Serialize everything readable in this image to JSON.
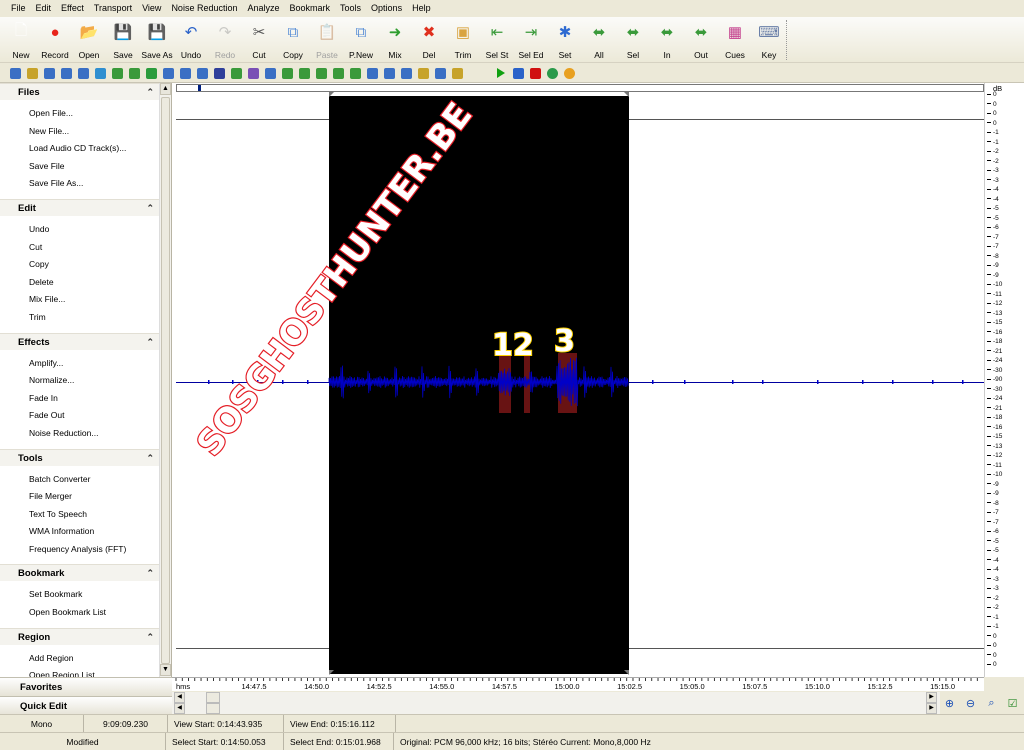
{
  "menu": [
    "File",
    "Edit",
    "Effect",
    "Transport",
    "View",
    "Noise Reduction",
    "Analyze",
    "Bookmark",
    "Tools",
    "Options",
    "Help"
  ],
  "toolbar": [
    {
      "label": "New",
      "icon": "new-file-icon",
      "glyph": "🗋",
      "color": "#ffffff",
      "disabled": false
    },
    {
      "label": "Record",
      "icon": "record-icon",
      "glyph": "●",
      "color": "#e8241a",
      "disabled": false
    },
    {
      "label": "Open",
      "icon": "folder-open-icon",
      "glyph": "📂",
      "color": "#f3c64a",
      "disabled": false
    },
    {
      "label": "Save",
      "icon": "save-icon",
      "glyph": "💾",
      "color": "#3d6fb5",
      "disabled": false
    },
    {
      "label": "Save As",
      "icon": "save-as-icon",
      "glyph": "💾",
      "color": "#3d6fb5",
      "disabled": false
    },
    {
      "label": "Undo",
      "icon": "undo-icon",
      "glyph": "↶",
      "color": "#2a62c9",
      "disabled": false
    },
    {
      "label": "Redo",
      "icon": "redo-icon",
      "glyph": "↷",
      "color": "#888888",
      "disabled": true
    },
    {
      "label": "Cut",
      "icon": "scissors-icon",
      "glyph": "✂",
      "color": "#555555",
      "disabled": false
    },
    {
      "label": "Copy",
      "icon": "copy-icon",
      "glyph": "⧉",
      "color": "#5a8fd6",
      "disabled": false
    },
    {
      "label": "Paste",
      "icon": "paste-icon",
      "glyph": "📋",
      "color": "#888888",
      "disabled": true
    },
    {
      "label": "P.New",
      "icon": "paste-new-icon",
      "glyph": "⧉",
      "color": "#5a8fd6",
      "disabled": false
    },
    {
      "label": "Mix",
      "icon": "mix-icon",
      "glyph": "➜",
      "color": "#2f9e2f",
      "disabled": false
    },
    {
      "label": "Del",
      "icon": "delete-icon",
      "glyph": "✖",
      "color": "#e0301e",
      "disabled": false
    },
    {
      "label": "Trim",
      "icon": "trim-icon",
      "glyph": "▣",
      "color": "#d9a441",
      "disabled": false
    },
    {
      "label": "Sel St",
      "icon": "select-start-icon",
      "glyph": "⇤",
      "color": "#3a9a3a",
      "disabled": false
    },
    {
      "label": "Sel Ed",
      "icon": "select-end-icon",
      "glyph": "⇥",
      "color": "#3a9a3a",
      "disabled": false
    },
    {
      "label": "Set",
      "icon": "set-marker-icon",
      "glyph": "✱",
      "color": "#2e6ad1",
      "disabled": false
    },
    {
      "label": "All",
      "icon": "select-all-icon",
      "glyph": "⬌",
      "color": "#3a9a3a",
      "disabled": false
    },
    {
      "label": "Sel",
      "icon": "select-icon",
      "glyph": "⬌",
      "color": "#3a9a3a",
      "disabled": false
    },
    {
      "label": "In",
      "icon": "zoom-in-region-icon",
      "glyph": "⬌",
      "color": "#3a9a3a",
      "disabled": false
    },
    {
      "label": "Out",
      "icon": "zoom-out-region-icon",
      "glyph": "⬌",
      "color": "#3a9a3a",
      "disabled": false
    },
    {
      "label": "Cues",
      "icon": "cues-icon",
      "glyph": "▦",
      "color": "#c23b8a",
      "disabled": false
    },
    {
      "label": "Key",
      "icon": "keyboard-icon",
      "glyph": "⌨",
      "color": "#6a7fa8",
      "disabled": false
    }
  ],
  "toolbar2_colors": [
    "#3a6fc4",
    "#c7a32a",
    "#3a6fc4",
    "#3a6fc4",
    "#3a6fc4",
    "#2f8fd0",
    "#3a9a3a",
    "#3a9a3a",
    "#2b9c3c",
    "#3a6fc4",
    "#3a6fc4",
    "#3a6fc4",
    "#2f3f9a",
    "#3a9a3a",
    "#7a4fb5",
    "#3a6fc4",
    "#3a9a3a",
    "#3a9a3a",
    "#3a9a3a",
    "#3a9a3a",
    "#3a9a3a",
    "#3a6fc4",
    "#3a6fc4",
    "#3a6fc4",
    "#c7a32a",
    "#3a6fc4",
    "#c7a32a"
  ],
  "transport_colors": [
    "#10a010",
    "#2a62c9",
    "#d01010",
    "#2a9a4a",
    "#e8a020"
  ],
  "sidebar": {
    "sections": [
      {
        "title": "Files",
        "items": [
          "Open File...",
          "New File...",
          "Load Audio CD Track(s)...",
          "Save File",
          "Save File As..."
        ]
      },
      {
        "title": "Edit",
        "items": [
          "Undo",
          "Cut",
          "Copy",
          "Delete",
          "Mix File...",
          "Trim"
        ]
      },
      {
        "title": "Effects",
        "items": [
          "Amplify...",
          "Normalize...",
          "Fade In",
          "Fade Out",
          "Noise Reduction..."
        ]
      },
      {
        "title": "Tools",
        "items": [
          "Batch Converter",
          "File Merger",
          "Text To Speech",
          "WMA Information",
          "Frequency Analysis (FFT)"
        ]
      },
      {
        "title": "Bookmark",
        "items": [
          "Set Bookmark",
          "Open Bookmark List"
        ]
      },
      {
        "title": "Region",
        "items": [
          "Add Region",
          "Open Region List"
        ]
      }
    ],
    "chevron": "⌃",
    "tabs": [
      "Favorites",
      "Quick Edit"
    ]
  },
  "watermark": "SOSGHOSTHUNTER.BE",
  "annotations": [
    "12",
    "3"
  ],
  "colors": {
    "waveform": "#0000c8",
    "selection": "#000000",
    "highlight": "#7a1616",
    "watermark": "#e41e26",
    "annotation": "#ffd400"
  },
  "db_scale": {
    "unit": "dB",
    "ticks": [
      "0",
      "0",
      "0",
      "0",
      "-1",
      "-1",
      "-2",
      "-2",
      "-3",
      "-3",
      "-4",
      "-4",
      "-5",
      "-5",
      "-6",
      "-7",
      "-7",
      "-8",
      "-9",
      "-9",
      "-10",
      "-11",
      "-12",
      "-13",
      "-15",
      "-16",
      "-18",
      "-21",
      "-24",
      "-30",
      "-90",
      "-30",
      "-24",
      "-21",
      "-18",
      "-16",
      "-15",
      "-13",
      "-12",
      "-11",
      "-10",
      "-9",
      "-9",
      "-8",
      "-7",
      "-7",
      "-6",
      "-5",
      "-5",
      "-4",
      "-4",
      "-3",
      "-3",
      "-2",
      "-2",
      "-1",
      "-1",
      "0",
      "0",
      "0",
      "0"
    ]
  },
  "ruler": {
    "unit": "hms",
    "labels": [
      "14:47.5",
      "14:50.0",
      "14:52.5",
      "14:55.0",
      "14:57.5",
      "15:00.0",
      "15:02.5",
      "15:05.0",
      "15:07.5",
      "15:10.0",
      "15:12.5",
      "15:15.0"
    ]
  },
  "status": {
    "row1": {
      "mode": "Mono",
      "duration": "9:09:09.230",
      "view_start": "View Start: 0:14:43.935",
      "view_end": "View End: 0:15:16.112"
    },
    "row2": {
      "state": "Modified",
      "select_start": "Select Start: 0:14:50.053",
      "select_end": "Select End: 0:15:01.968",
      "format": "Original: PCM 96,000 kHz; 16 bits; Stéréo Current: Mono,8,000 Hz"
    }
  },
  "zoom_icons": [
    "zoom-in-icon",
    "zoom-out-icon",
    "zoom-fit-icon",
    "checkbox-icon"
  ]
}
